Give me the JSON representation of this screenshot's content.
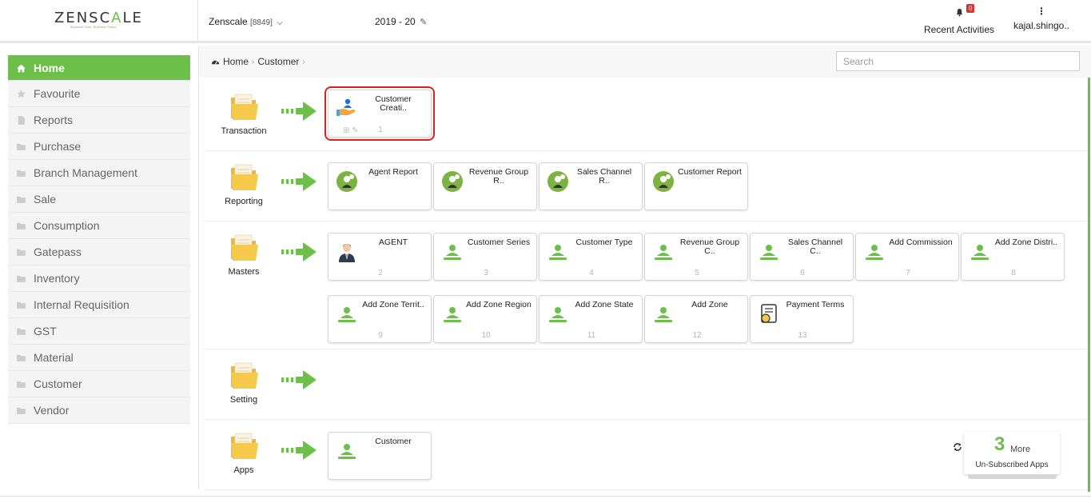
{
  "header": {
    "brand": {
      "part1": "ZENSC",
      "part2": "A",
      "part3": "LE",
      "tagline": "Business Ease. Business Peace."
    },
    "company": {
      "name": "Zenscale",
      "code": "[8849]"
    },
    "year": "2019 - 20",
    "notifications": {
      "count": "0",
      "label": "Recent Activities"
    },
    "user": {
      "label": "kajal.shingo.."
    }
  },
  "sidebar": {
    "items": [
      {
        "label": "Home",
        "icon": "home-icon",
        "active": true
      },
      {
        "label": "Favourite",
        "icon": "star-icon"
      },
      {
        "label": "Reports",
        "icon": "file-icon"
      },
      {
        "label": "Purchase",
        "icon": "folder-icon"
      },
      {
        "label": "Branch Management",
        "icon": "folder-icon"
      },
      {
        "label": "Sale",
        "icon": "folder-icon"
      },
      {
        "label": "Consumption",
        "icon": "folder-icon"
      },
      {
        "label": "Gatepass",
        "icon": "folder-icon"
      },
      {
        "label": "Inventory",
        "icon": "folder-icon"
      },
      {
        "label": "Internal Requisition",
        "icon": "folder-icon"
      },
      {
        "label": "GST",
        "icon": "folder-icon"
      },
      {
        "label": "Material",
        "icon": "folder-icon"
      },
      {
        "label": "Customer",
        "icon": "folder-icon"
      },
      {
        "label": "Vendor",
        "icon": "folder-icon"
      }
    ]
  },
  "breadcrumb": {
    "home": "Home",
    "current": "Customer"
  },
  "search": {
    "placeholder": "Search"
  },
  "sections": {
    "transaction": {
      "label": "Transaction",
      "tiles": [
        {
          "title": "Customer Creati..",
          "num": "1",
          "icon": "customer-hand-icon"
        }
      ]
    },
    "reporting": {
      "label": "Reporting",
      "tiles": [
        {
          "title": "Agent Report",
          "num": "",
          "icon": "report-icon"
        },
        {
          "title": "Revenue Group R..",
          "num": "",
          "icon": "report-icon"
        },
        {
          "title": "Sales Channel R..",
          "num": "",
          "icon": "report-icon"
        },
        {
          "title": "Customer Report",
          "num": "",
          "icon": "report-icon"
        }
      ]
    },
    "masters": {
      "label": "Masters",
      "tiles": [
        {
          "title": "AGENT",
          "num": "2",
          "icon": "agent-icon"
        },
        {
          "title": "Customer Series",
          "num": "3",
          "icon": "user-green-icon"
        },
        {
          "title": "Customer Type",
          "num": "4",
          "icon": "user-green-icon"
        },
        {
          "title": "Revenue Group C..",
          "num": "5",
          "icon": "user-green-icon"
        },
        {
          "title": "Sales Channel C..",
          "num": "6",
          "icon": "user-green-icon"
        },
        {
          "title": "Add Commission",
          "num": "7",
          "icon": "user-green-icon"
        },
        {
          "title": "Add Zone Distri..",
          "num": "8",
          "icon": "user-green-icon"
        },
        {
          "title": "Add Zone Territ..",
          "num": "9",
          "icon": "user-green-icon"
        },
        {
          "title": "Add Zone Region",
          "num": "10",
          "icon": "user-green-icon"
        },
        {
          "title": "Add Zone State",
          "num": "11",
          "icon": "user-green-icon"
        },
        {
          "title": "Add Zone",
          "num": "12",
          "icon": "user-green-icon"
        },
        {
          "title": "Payment Terms",
          "num": "13",
          "icon": "payment-terms-icon"
        }
      ]
    },
    "setting": {
      "label": "Setting",
      "tiles": []
    },
    "apps": {
      "label": "Apps",
      "tiles": [
        {
          "title": "Customer",
          "num": "",
          "icon": "user-green-icon"
        }
      ]
    }
  },
  "more": {
    "count": "3",
    "word": "More",
    "subtitle": "Un-Subscribed Apps"
  },
  "colors": {
    "accent": "#6cc04a",
    "highlight": "#e02020",
    "badge": "#d9342b"
  }
}
